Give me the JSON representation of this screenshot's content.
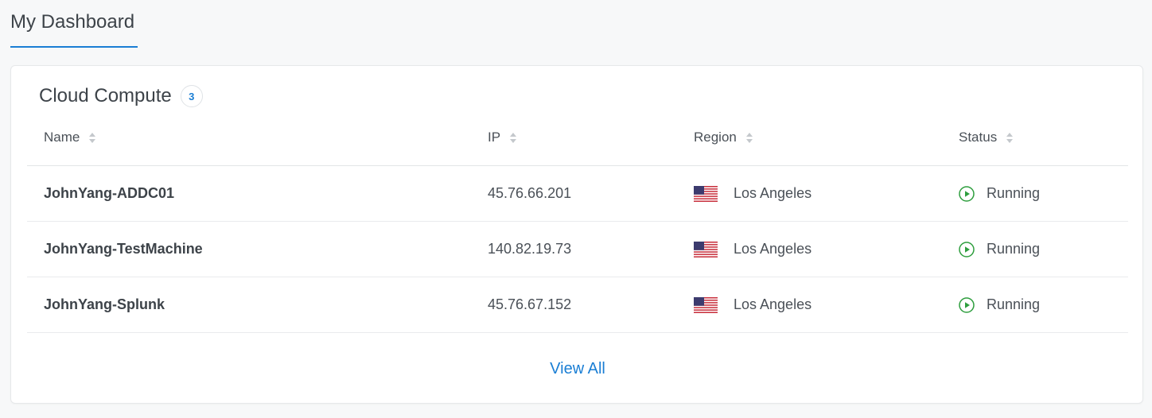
{
  "page": {
    "tab_label": "My Dashboard"
  },
  "card": {
    "title": "Cloud Compute",
    "count": "3",
    "view_all_label": "View All"
  },
  "table": {
    "columns": {
      "name": "Name",
      "ip": "IP",
      "region": "Region",
      "status": "Status"
    },
    "rows": [
      {
        "name": "JohnYang-ADDC01",
        "ip": "45.76.66.201",
        "region": "Los Angeles",
        "flag": "us-flag-icon",
        "status": "Running"
      },
      {
        "name": "JohnYang-TestMachine",
        "ip": "140.82.19.73",
        "region": "Los Angeles",
        "flag": "us-flag-icon",
        "status": "Running"
      },
      {
        "name": "JohnYang-Splunk",
        "ip": "45.76.67.152",
        "region": "Los Angeles",
        "flag": "us-flag-icon",
        "status": "Running"
      }
    ]
  },
  "colors": {
    "accent": "#1a7ed4",
    "running": "#2e9e3e"
  }
}
